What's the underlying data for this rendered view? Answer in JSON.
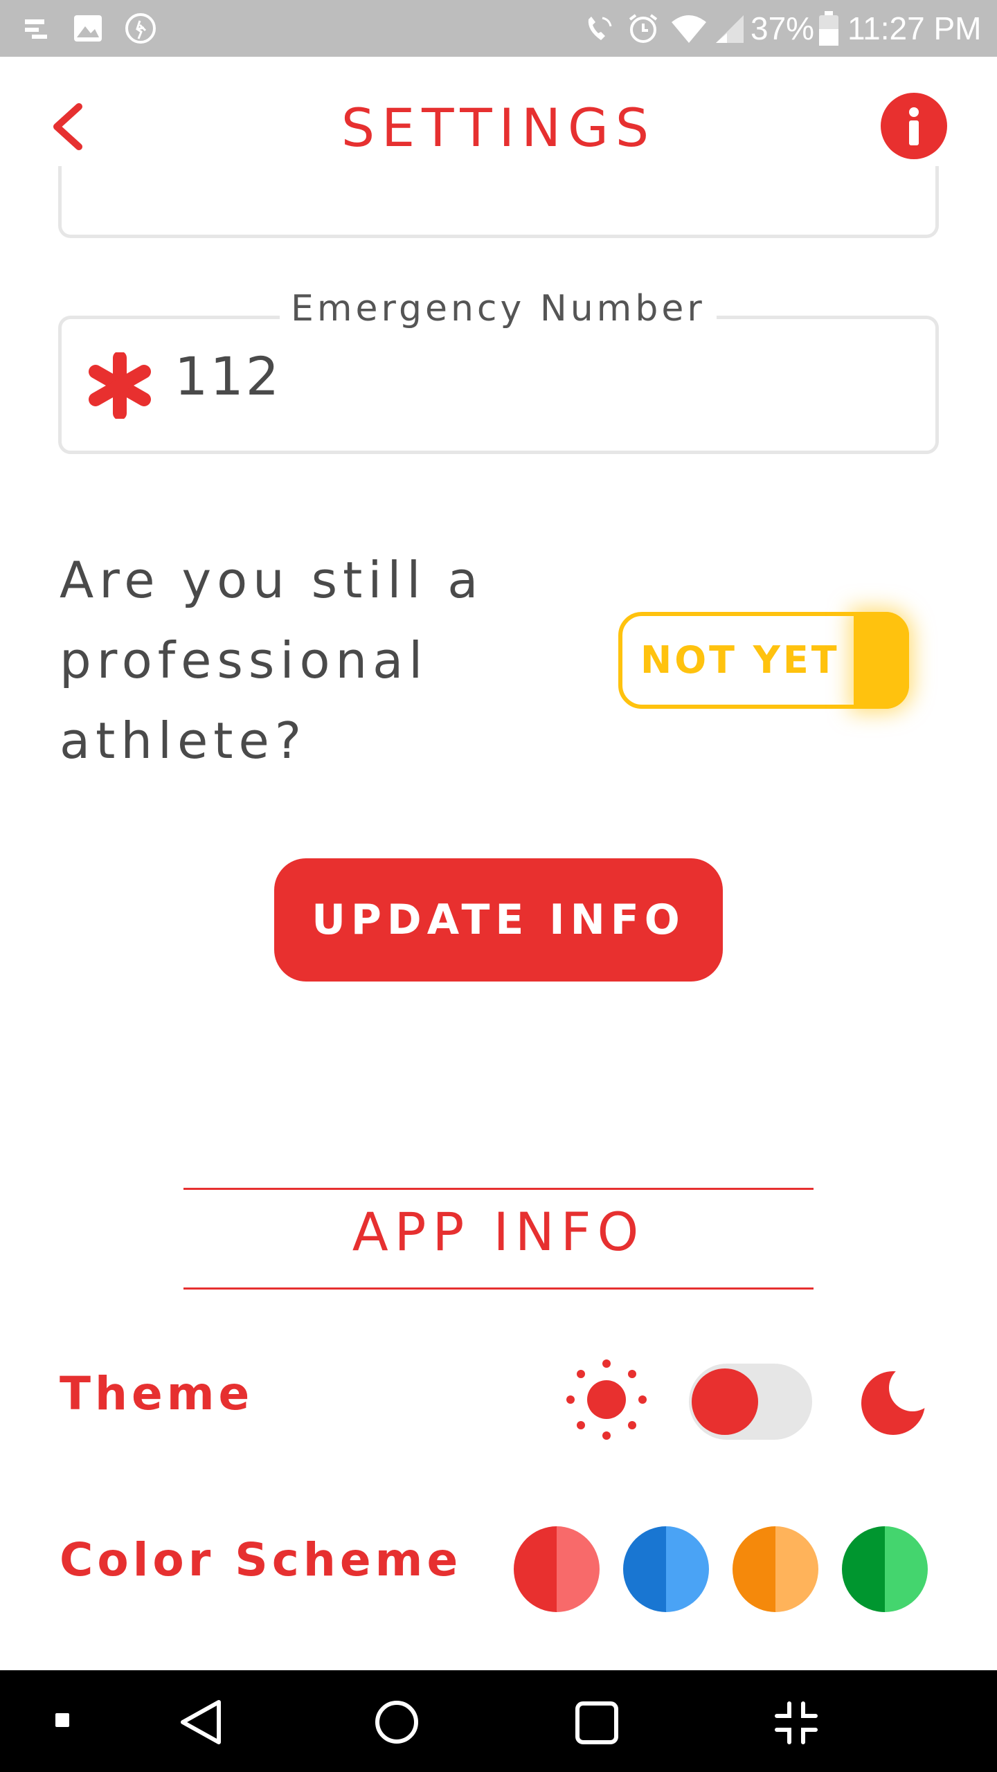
{
  "status_bar": {
    "battery": "37%",
    "time": "11:27 PM"
  },
  "header": {
    "title": "SETTINGS"
  },
  "emergency": {
    "legend": "Emergency Number",
    "value": "112"
  },
  "pro_question": {
    "lines": [
      "Are you still a",
      "professional",
      "athlete?"
    ],
    "toggle_label": "NOT YET"
  },
  "update_button": {
    "label": "UPDATE INFO"
  },
  "app_info": {
    "title": "APP INFO",
    "theme_label": "Theme",
    "color_scheme_label": "Color Scheme"
  },
  "colors": {
    "accent": "#e8302f",
    "yellow": "#ffc20e",
    "swatches": [
      {
        "left": "#e8302f",
        "right": "#f86a6a"
      },
      {
        "left": "#1976d2",
        "right": "#4aa3f5"
      },
      {
        "left": "#f5890b",
        "right": "#ffb35a"
      },
      {
        "left": "#00962f",
        "right": "#44d56e"
      }
    ]
  },
  "icons": {
    "back": "chevron-left-icon",
    "info": "info-icon",
    "asterisk": "asterisk-icon",
    "sun": "sun-icon",
    "moon": "moon-icon"
  }
}
